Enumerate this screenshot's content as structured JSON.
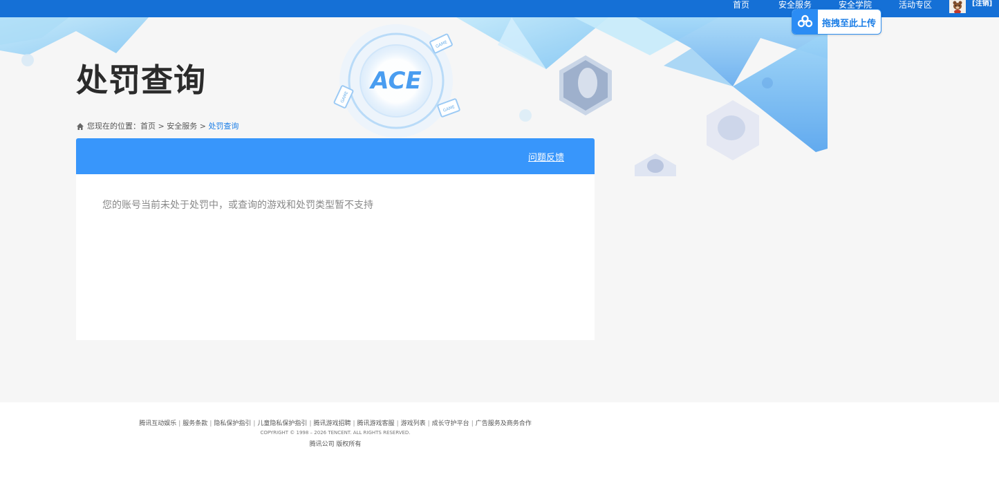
{
  "topnav": {
    "items": [
      {
        "label": "首页"
      },
      {
        "label": "安全服务"
      },
      {
        "label": "安全学院"
      },
      {
        "label": "活动专区"
      }
    ],
    "logout_label": "[注销]"
  },
  "upload": {
    "label": "拖拽至此上传"
  },
  "hero": {
    "title": "处罚查询",
    "logo_text": "ACE",
    "game_tag": "GAME"
  },
  "breadcrumb": {
    "prefix": "您现在的位置：",
    "items": [
      "首页",
      "安全服务",
      "处罚查询"
    ],
    "separator": " > "
  },
  "card": {
    "feedback_label": "问题反馈",
    "message": "您的账号当前未处于处罚中，或查询的游戏和处罚类型暂不支持"
  },
  "footer": {
    "links": [
      "腾讯互动娱乐",
      "服务条款",
      "隐私保护指引",
      "儿童隐私保护指引",
      "腾讯游戏招聘",
      "腾讯游戏客服",
      "游戏列表",
      "成长守护平台",
      "广告服务及商务合作"
    ],
    "separator": "|",
    "copyright": "COPYRIGHT © 1998 – 2026 TENCENT. ALL RIGHTS RESERVED.",
    "company": "腾讯公司 版权所有"
  },
  "colors": {
    "topbar": "#1570d6",
    "accent": "#3896fb",
    "link_current": "#1a7de6"
  }
}
